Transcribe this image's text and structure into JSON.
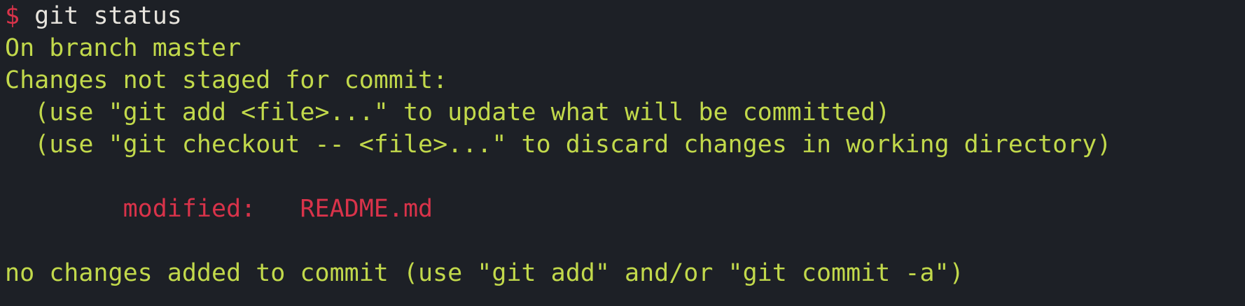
{
  "terminal": {
    "prompt_symbol": "$",
    "command": "git status",
    "colors": {
      "background": "#1d2026",
      "output_text": "#c2d94b",
      "prompt": "#d9334a",
      "command_text": "#e7e4dd",
      "modified": "#d9334a"
    },
    "output": {
      "branch_line": "On branch master",
      "changes_header": "Changes not staged for commit:",
      "hint_add": "  (use \"git add <file>...\" to update what will be committed)",
      "hint_checkout": "  (use \"git checkout -- <file>...\" to discard changes in working directory)",
      "modified_indent": "        ",
      "modified_label": "modified:",
      "modified_gap": "   ",
      "modified_file": "README.md",
      "summary_line": "no changes added to commit (use \"git add\" and/or \"git commit -a\")"
    }
  }
}
